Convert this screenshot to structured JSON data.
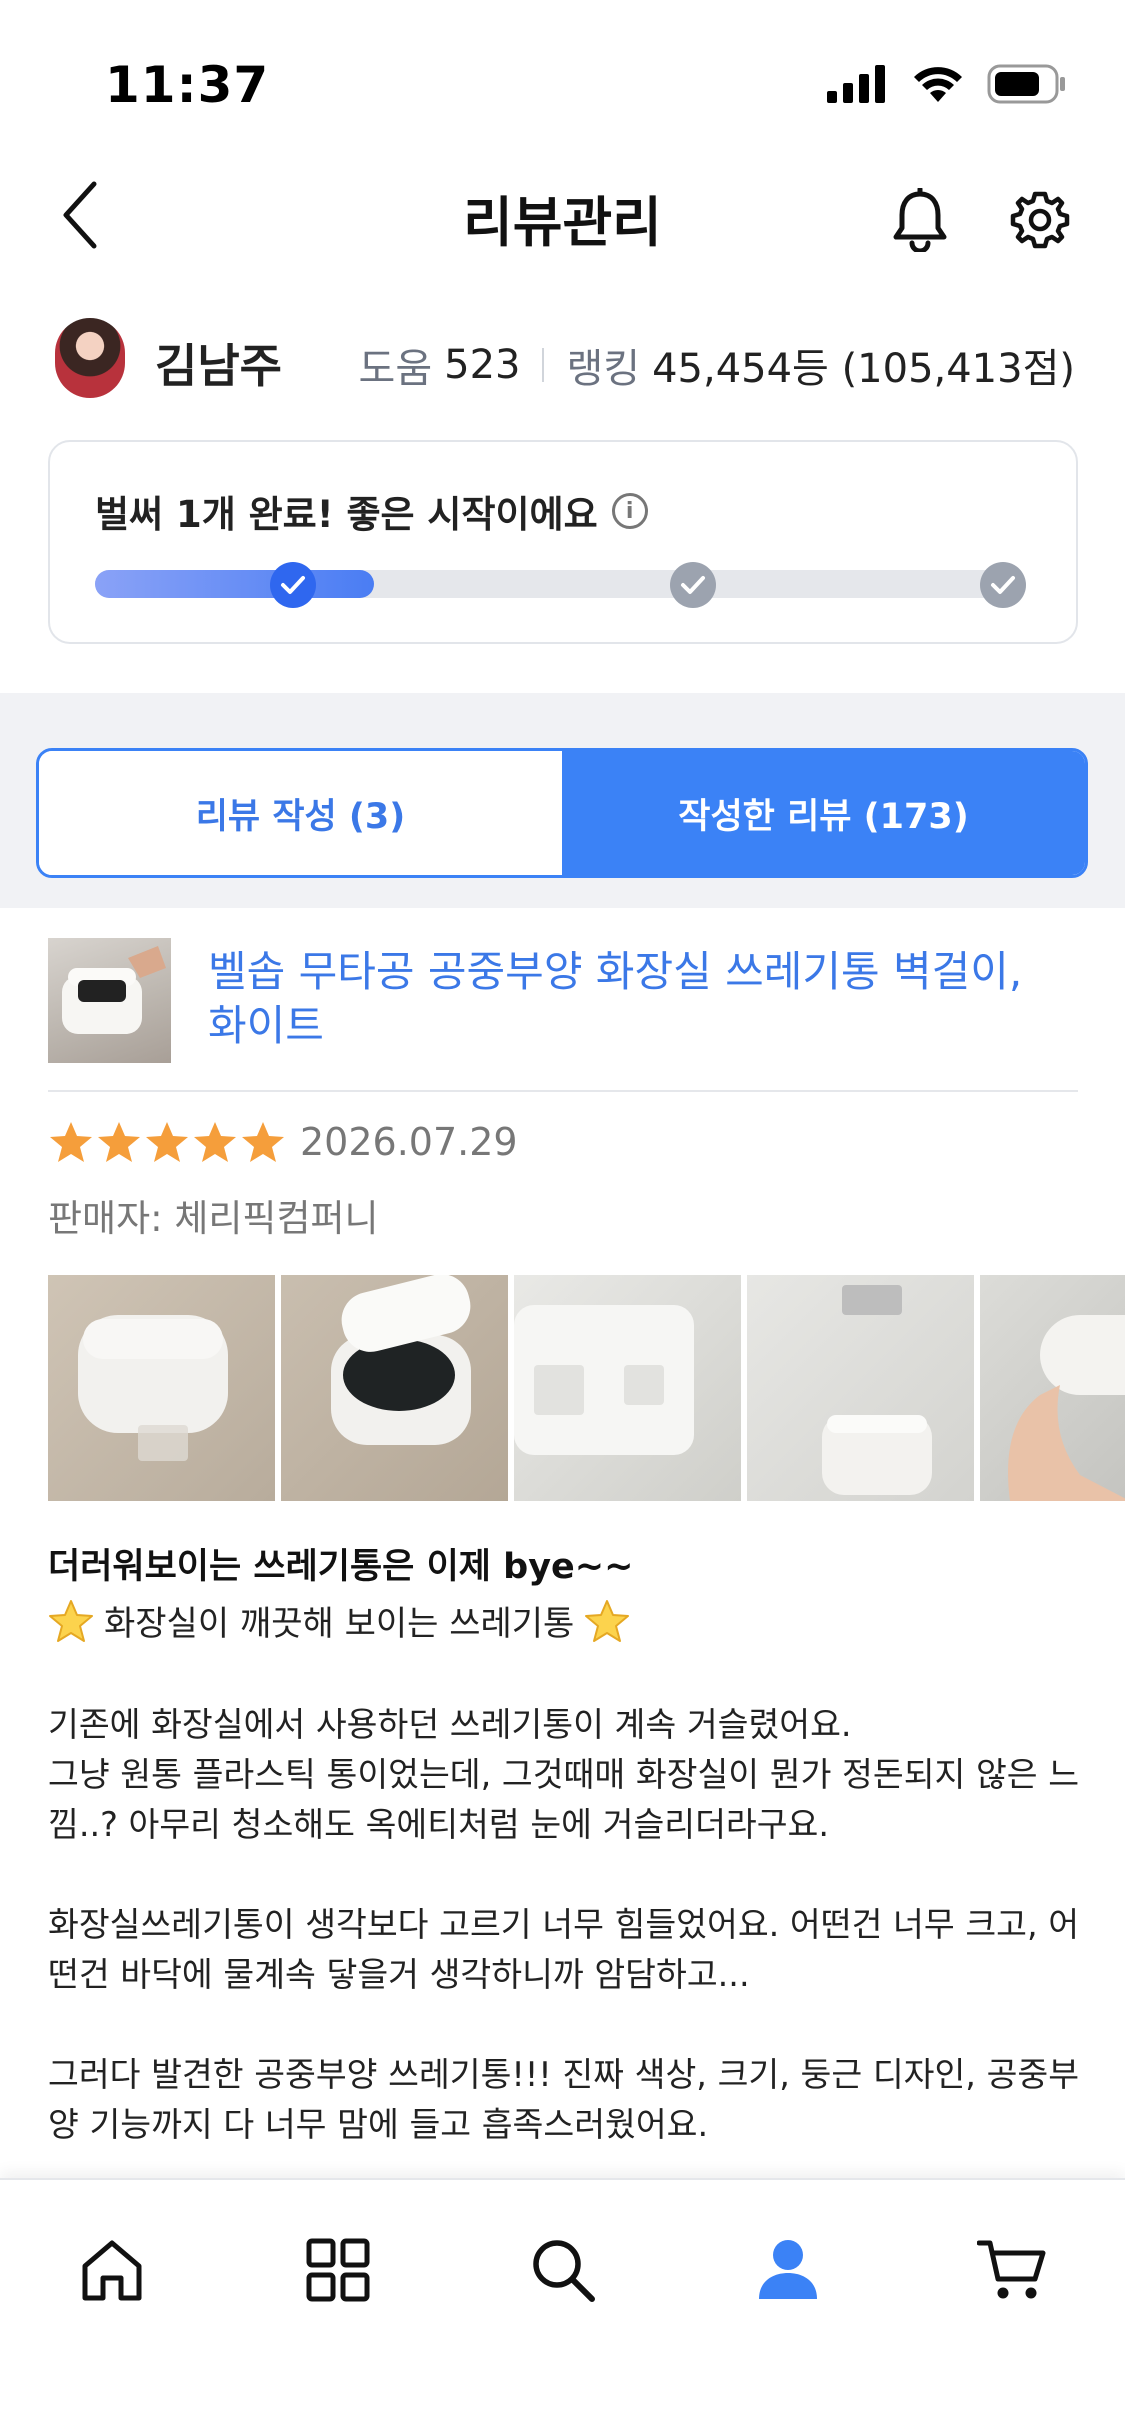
{
  "status_bar": {
    "time": "11:37"
  },
  "header": {
    "title": "리뷰관리"
  },
  "profile": {
    "name": "김남주",
    "help_label": "도움",
    "help_value": "523",
    "ranking_label": "랭킹",
    "ranking_value": "45,454등 (105,413점)"
  },
  "progress": {
    "message": "벌써 1개 완료! 좋은 시작이에요",
    "completed_steps": 1,
    "total_steps": 3,
    "fill_fraction": 0.3
  },
  "tabs": [
    {
      "label": "리뷰 작성 (3)",
      "active": false
    },
    {
      "label": "작성한 리뷰 (173)",
      "active": true
    }
  ],
  "review": {
    "product_title": "벨솝 무타공 공중부양 화장실 쓰레기통 벽걸이, 화이트",
    "rating": 5,
    "date": "2026.07.29",
    "seller": "판매자: 체리픽컴퍼니",
    "headline": "더러워보이는 쓰레기통은 이제 bye~~",
    "subline": "화장실이 깨끗해 보이는 쓰레기통",
    "paragraphs": [
      "기존에 화장실에서 사용하던 쓰레기통이 계속 거슬렸어요.\n그냥 원통 플라스틱 통이었는데, 그것때매 화장실이 뭔가 정돈되지 않은 느낌..? 아무리 청소해도 옥에티처럼 눈에 거슬리더라구요.",
      "화장실쓰레기통이 생각보다 고르기 너무 힘들었어요. 어떤건 너무 크고, 어떤건 바닥에 물계속 닿을거 생각하니까 암담하고...",
      "그러다 발견한 공중부양 쓰레기통!!! 진짜 색상, 크기, 둥근 디자인, 공중부양 기능까지 다 너무 맘에 들고 흡족스러웠어요."
    ]
  },
  "colors": {
    "accent": "#3b82f6",
    "link": "#3b78e7",
    "star": "#f59e3b",
    "muted": "#777777"
  },
  "tabbar": {
    "items": [
      "home-icon",
      "grid-icon",
      "search-icon",
      "person-icon",
      "cart-icon"
    ],
    "active": "person-icon"
  }
}
